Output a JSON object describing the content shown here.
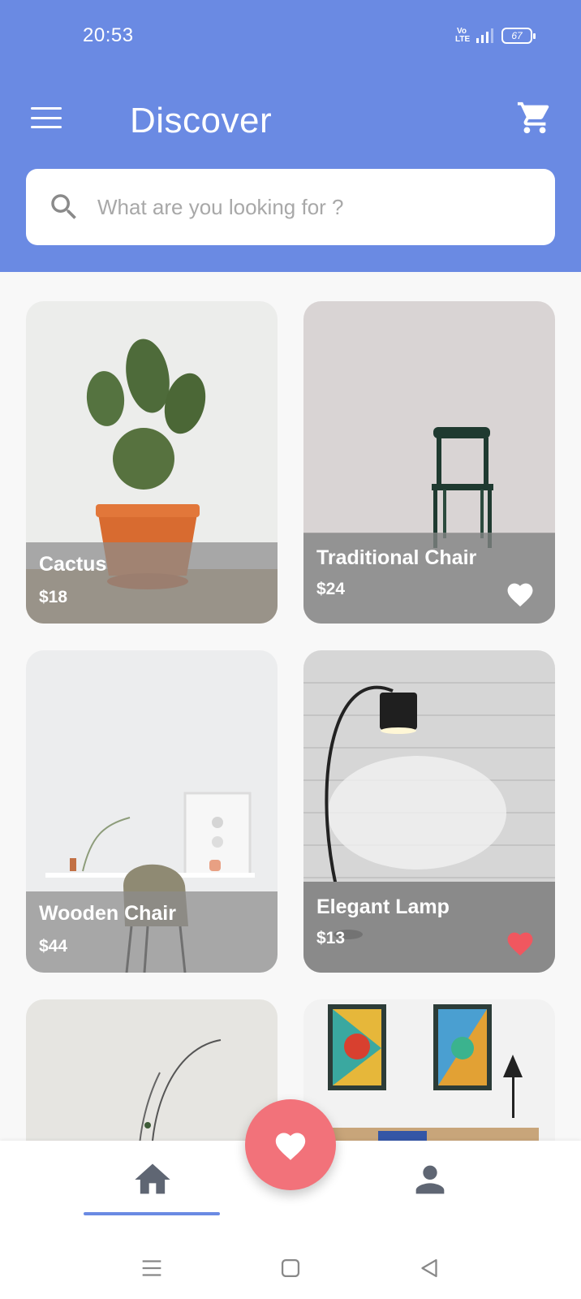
{
  "status_bar": {
    "time": "20:53",
    "volte": "Vo LTE",
    "battery": "67"
  },
  "header": {
    "title": "Discover",
    "menu_icon": "hamburger-menu-icon",
    "cart_icon": "shopping-cart-icon"
  },
  "search": {
    "placeholder": "What are you looking for ?",
    "icon": "search-icon"
  },
  "products": [
    {
      "name": "Cactus",
      "price": "$18",
      "favorite": false
    },
    {
      "name": "Traditional Chair",
      "price": "$24",
      "favorite": true,
      "heart_color": "#ffffff"
    },
    {
      "name": "Wooden Chair",
      "price": "$44",
      "favorite": false
    },
    {
      "name": "Elegant Lamp",
      "price": "$13",
      "favorite": true,
      "heart_color": "#f0575f"
    }
  ],
  "bottom_nav": {
    "items": [
      "home-icon",
      "profile-icon"
    ],
    "active": "home",
    "fab_icon": "heart-icon"
  },
  "colors": {
    "primary": "#6a8ae3",
    "fab": "#f2727a",
    "favorite_red": "#f0575f"
  }
}
